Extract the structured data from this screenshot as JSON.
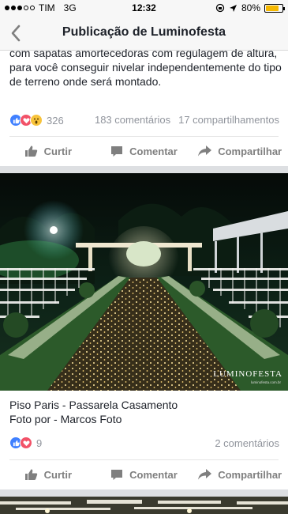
{
  "status_bar": {
    "carrier": "TIM",
    "network": "3G",
    "time": "12:32",
    "battery": "80%",
    "battery_level": 0.8,
    "signal_bars": 3,
    "signal_max": 5
  },
  "nav": {
    "title": "Publicação de Luminofesta",
    "back_icon": "chevron-left-icon"
  },
  "post1": {
    "text": "com sapatas amortecedoras com regulagem de altura, para você conseguir nivelar independentemente do tipo de terreno onde será montado.",
    "reaction_count": "326",
    "comments": "183 comentários",
    "shares": "17 compartilhamentos"
  },
  "actions": {
    "like": "Curtir",
    "comment": "Comentar",
    "share": "Compartilhar"
  },
  "post2": {
    "watermark": "LUMINOFESTA",
    "watermark_sub": "luminofesta.com.br",
    "caption_line1": "Piso Paris - Passarela Casamento",
    "caption_line2": "Foto por - Marcos Foto",
    "reaction_count": "9",
    "comments": "2 comentários"
  },
  "colors": {
    "like": "#4080ff",
    "love": "#f25268",
    "wow": "#f7c33b",
    "muted": "#90949c"
  }
}
